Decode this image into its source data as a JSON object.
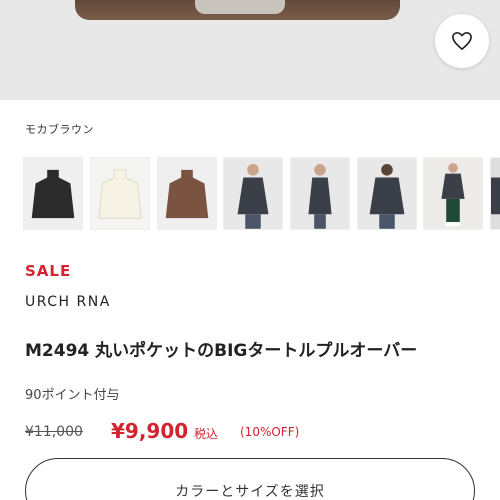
{
  "product": {
    "favorite_icon": "heart-outline-icon",
    "color_name": "モカブラウン",
    "thumbnails": [
      {
        "name": "black-sweater"
      },
      {
        "name": "ivory-sweater"
      },
      {
        "name": "mocha-brown-sweater"
      },
      {
        "name": "model-front"
      },
      {
        "name": "model-side"
      },
      {
        "name": "model-back"
      },
      {
        "name": "model-full-length"
      },
      {
        "name": "model-partial"
      }
    ],
    "sale_label": "SALE",
    "brand": "URCH RNA",
    "title": "M2494 丸いポケットのBIGタートルプルオーバー",
    "points": "90ポイント付与",
    "original_price": "¥11,000",
    "price": "¥9,900",
    "tax_label": "税込",
    "discount": "(10%OFF)",
    "select_button": "カラーとサイズを選択"
  },
  "colors": {
    "sale_red": "#d4232f",
    "mocha": "#7a5c48"
  }
}
